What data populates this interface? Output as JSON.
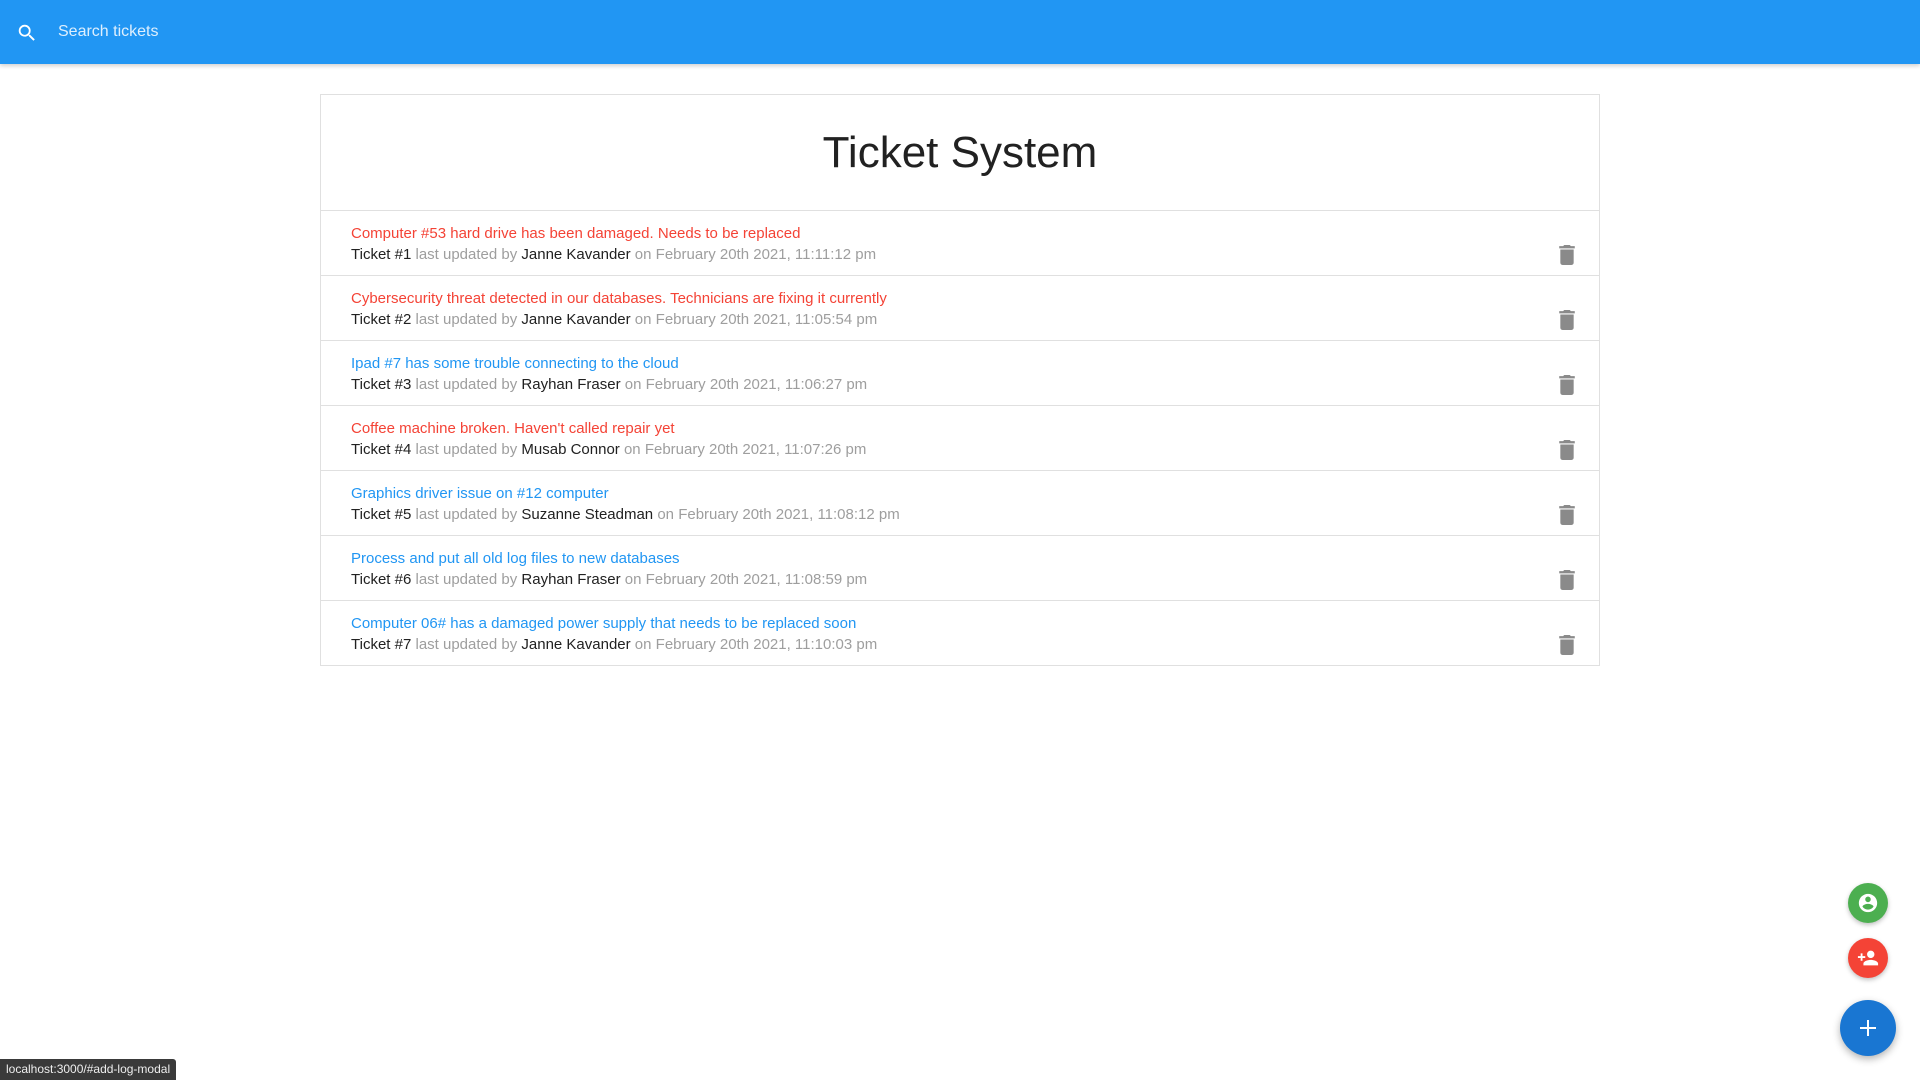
{
  "search": {
    "placeholder": "Search tickets"
  },
  "header": {
    "title": "Ticket System"
  },
  "meta_text": {
    "last_updated_by": " last updated by ",
    "on": " on "
  },
  "tickets": [
    {
      "title": "Computer #53 hard drive has been damaged. Needs to be replaced",
      "ticket_label": "Ticket #1",
      "user": "Janne Kavander",
      "date": "February 20th 2021, 11:11:12 pm",
      "color": "#f44336"
    },
    {
      "title": "Cybersecurity threat detected in our databases. Technicians are fixing it currently",
      "ticket_label": "Ticket #2",
      "user": "Janne Kavander",
      "date": "February 20th 2021, 11:05:54 pm",
      "color": "#f44336"
    },
    {
      "title": "Ipad #7 has some trouble connecting to the cloud",
      "ticket_label": "Ticket #3",
      "user": "Rayhan Fraser",
      "date": "February 20th 2021, 11:06:27 pm",
      "color": "#2196f3"
    },
    {
      "title": "Coffee machine broken. Haven't called repair yet",
      "ticket_label": "Ticket #4",
      "user": "Musab Connor",
      "date": "February 20th 2021, 11:07:26 pm",
      "color": "#f44336"
    },
    {
      "title": "Graphics driver issue on #12 computer",
      "ticket_label": "Ticket #5",
      "user": "Suzanne Steadman",
      "date": "February 20th 2021, 11:08:12 pm",
      "color": "#2196f3"
    },
    {
      "title": "Process and put all old log files to new databases",
      "ticket_label": "Ticket #6",
      "user": "Rayhan Fraser",
      "date": "February 20th 2021, 11:08:59 pm",
      "color": "#2196f3"
    },
    {
      "title": "Computer 06# has a damaged power supply that needs to be replaced soon",
      "ticket_label": "Ticket #7",
      "user": "Janne Kavander",
      "date": "February 20th 2021, 11:10:03 pm",
      "color": "#2196f3"
    }
  ],
  "fabs": {
    "users": {
      "icon": "person-icon",
      "color": "#4caf50"
    },
    "add_user": {
      "icon": "person-add-icon",
      "color": "#f44336"
    },
    "add_log": {
      "icon": "plus-icon",
      "color": "#1976d2"
    }
  },
  "status_bar": {
    "url": "localhost:3000/#add-log-modal"
  },
  "colors": {
    "navbar": "#2196f3",
    "urgent": "#f44336",
    "normal": "#2196f3"
  }
}
